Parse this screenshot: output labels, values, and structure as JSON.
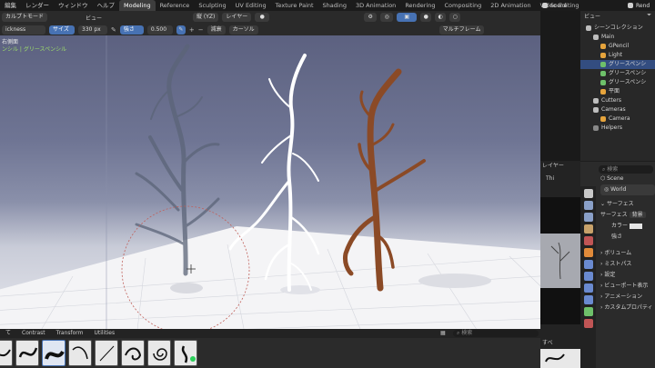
{
  "menu": {
    "items": [
      "編集",
      "レンダー",
      "ウィンドウ",
      "ヘルプ"
    ],
    "workspaces": [
      "Modeling",
      "Reference",
      "Sculpting",
      "UV Editing",
      "Texture Paint",
      "Shading",
      "3D Animation",
      "Rendering",
      "Compositing",
      "2D Animation",
      "Video Editing"
    ],
    "active_workspace": "Modeling",
    "scene": "Scene",
    "render_label": "Rend"
  },
  "viewport_header": {
    "mode": "カルプトモード",
    "view": "ビュー",
    "axis": "縦 (YZ)",
    "layer": "レイヤー"
  },
  "tool_header": {
    "brush_name": "ickness",
    "size_label": "サイズ",
    "size_value": "330 px",
    "strength_label": "強さ",
    "strength_value": "0.500",
    "falloff": "減衰",
    "cursor": "カーソル",
    "multiframe": "マルチフレーム"
  },
  "viewport_overlay": {
    "line1": "右側面",
    "line2": "ンシル | グリースペンシル"
  },
  "brush_tabs": [
    "て",
    "Contrast",
    "Transform",
    "Utilities"
  ],
  "search_placeholder": "検索",
  "outliner": {
    "top_label": "ビュー",
    "rows": [
      {
        "label": "シーンコレクション",
        "indent": 0,
        "color": "#bdbdbd"
      },
      {
        "label": "Main",
        "indent": 1,
        "color": "#bdbdbd"
      },
      {
        "label": "GPencil",
        "indent": 2,
        "color": "#e6a43c"
      },
      {
        "label": "Light",
        "indent": 2,
        "color": "#e6a43c"
      },
      {
        "label": "グリースペンシ",
        "indent": 2,
        "color": "#6ec06a",
        "selected": true
      },
      {
        "label": "グリースペンシ",
        "indent": 2,
        "color": "#6ec06a"
      },
      {
        "label": "グリースペンシ",
        "indent": 2,
        "color": "#6ec06a"
      },
      {
        "label": "平面",
        "indent": 2,
        "color": "#e6a43c"
      },
      {
        "label": "Cutters",
        "indent": 1,
        "color": "#bdbdbd"
      },
      {
        "label": "Cameras",
        "indent": 1,
        "color": "#bdbdbd"
      },
      {
        "label": "Camera",
        "indent": 2,
        "color": "#e6a43c"
      },
      {
        "label": "Helpers",
        "indent": 1,
        "color": "#888888"
      }
    ]
  },
  "midstrip": {
    "layer_label": "レイヤー",
    "thick_label": "Thi",
    "sub_label": "すべ"
  },
  "properties": {
    "search_placeholder": "検索",
    "scene": "Scene",
    "world": "World",
    "rows": [
      "サーフェス",
      "サーフェス",
      "カラー",
      "強さ",
      "ボリューム",
      "ミストパス",
      "設定",
      "ビューポート表示",
      "アニメーション",
      "カスタムプロパティ"
    ],
    "surface_value": "背景"
  },
  "colors": {
    "accent": "#4772b3",
    "active_tab": "#3d3d3d",
    "tree_white": "#ffffff",
    "tree_grey": "#5b6478",
    "tree_brown": "#8b4a26"
  }
}
